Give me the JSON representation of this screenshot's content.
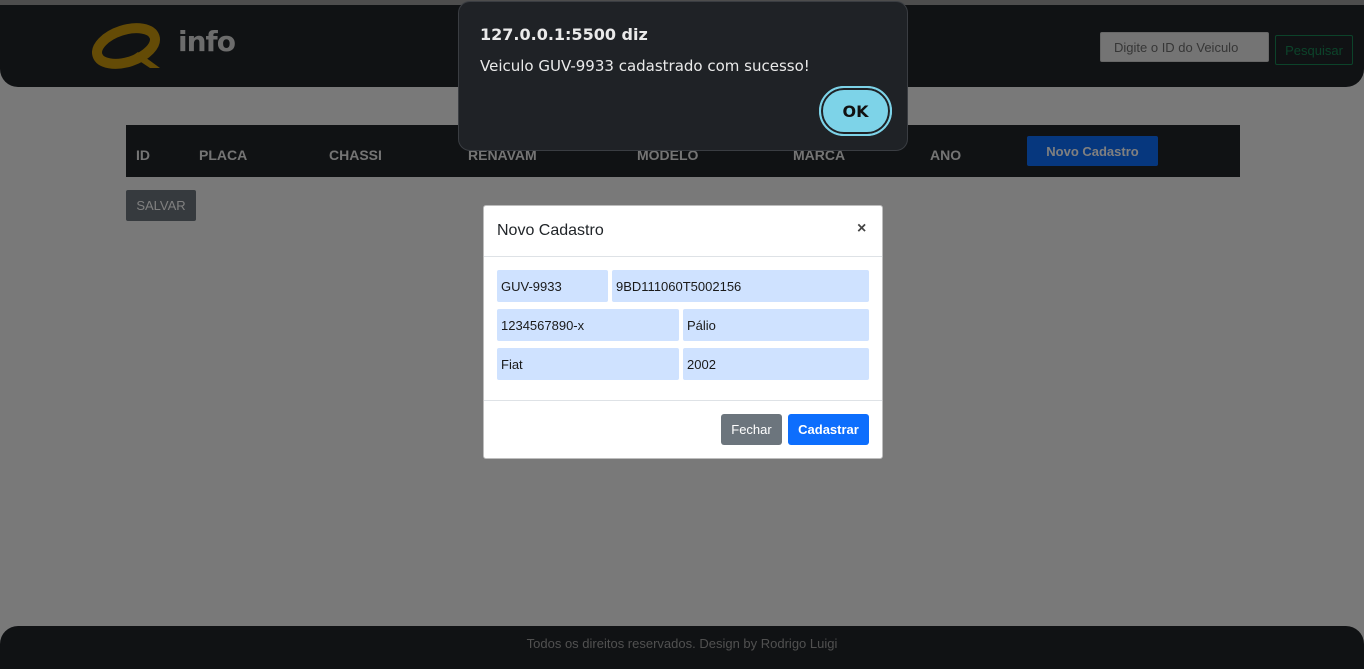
{
  "header": {
    "logo_text": "info",
    "search_placeholder": "Digite o ID do Veiculo",
    "search_button": "Pesquisar",
    "colors": {
      "bg": "#212529",
      "logo_accent": "#c8960c",
      "search_outline": "#198754"
    }
  },
  "table": {
    "columns": [
      "ID",
      "PLACA",
      "CHASSI",
      "RENAVAM",
      "MODELO",
      "MARCA",
      "ANO"
    ],
    "new_button": "Novo Cadastro"
  },
  "save_button": "SALVAR",
  "footer": {
    "text": "Todos os direitos reservados. Design by Rodrigo Luigi"
  },
  "modal": {
    "title": "Novo Cadastro",
    "close_icon": "×",
    "fields": {
      "placa": "GUV-9933",
      "chassi": "9BD111060T5002156",
      "renavam": "1234567890-x",
      "modelo": "Pálio",
      "marca": "Fiat",
      "ano": "2002"
    },
    "close_button": "Fechar",
    "submit_button": "Cadastrar"
  },
  "alert": {
    "title": "127.0.0.1:5500 diz",
    "message": "Veiculo GUV-9933 cadastrado com sucesso!",
    "ok_button": "OK"
  }
}
